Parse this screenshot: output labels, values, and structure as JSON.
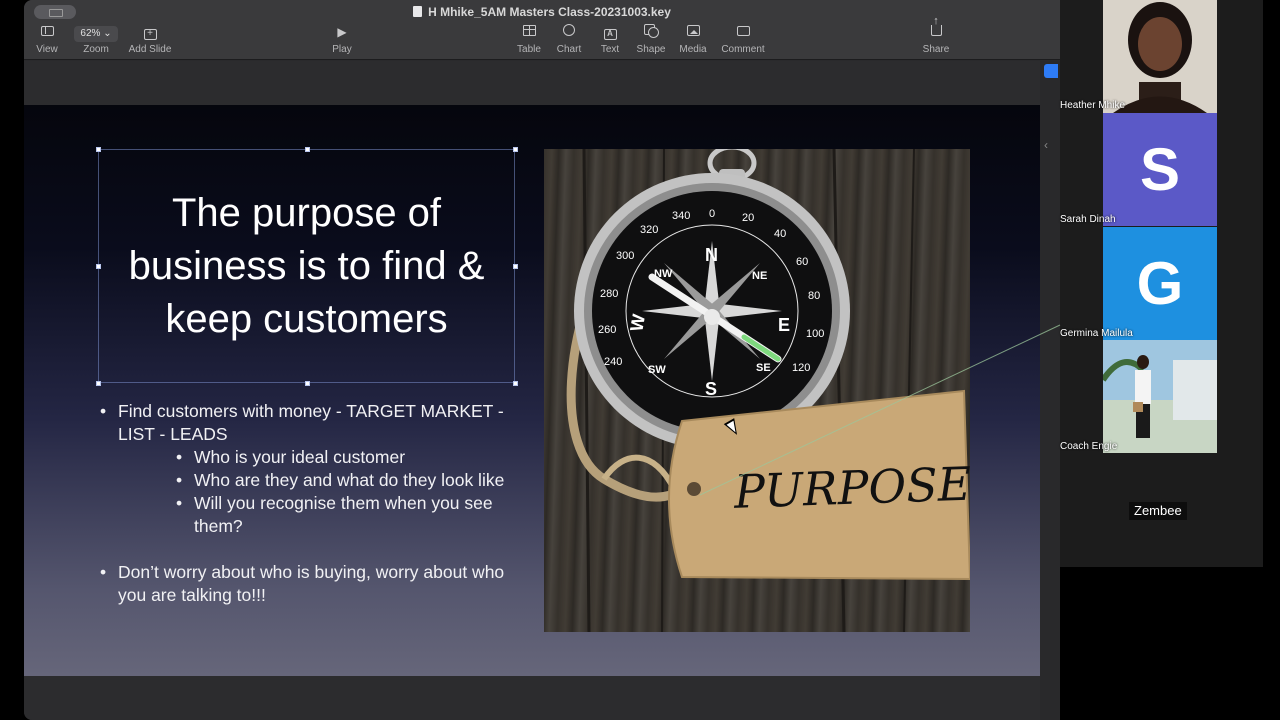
{
  "window": {
    "title": "H Mhike_5AM Masters Class-20231003.key"
  },
  "toolbar": {
    "view_label": "View",
    "zoom_label": "Zoom",
    "zoom_value": "62%",
    "add_slide_label": "Add Slide",
    "play_label": "Play",
    "table_label": "Table",
    "chart_label": "Chart",
    "text_label": "Text",
    "shape_label": "Shape",
    "media_label": "Media",
    "comment_label": "Comment",
    "share_label": "Share"
  },
  "slide": {
    "title": "The purpose of business is to find & keep customers",
    "bullets": {
      "b1": "Find customers with money - TARGET MARKET - LIST - LEADS",
      "b1_sub1": "Who is your ideal customer",
      "b1_sub2": "Who are they and what do they look like",
      "b1_sub3": "Will you recognise them when you see them?",
      "b2": "Don’t worry about who is buying, worry about who you are talking to!!!"
    },
    "image": {
      "tag_text": "PURPOSE",
      "compass_n": "N",
      "compass_e": "E",
      "compass_w": "W",
      "compass_s": "S",
      "compass_ne": "NE",
      "compass_nw": "NW",
      "compass_se": "SE",
      "compass_sw": "SW",
      "deg_0": "0",
      "deg_20": "20",
      "deg_40": "40",
      "deg_60": "60",
      "deg_80": "80",
      "deg_100": "100",
      "deg_120": "120",
      "deg_240": "240",
      "deg_260": "260",
      "deg_280": "280",
      "deg_300": "300",
      "deg_320": "320",
      "deg_340": "340"
    }
  },
  "participants": {
    "p1": {
      "name": "Heather Mhike"
    },
    "p2": {
      "name": "Sarah Dinah",
      "initial": "S",
      "color": "#5b59c7"
    },
    "p3": {
      "name": "Germina Mailula",
      "initial": "G",
      "color": "#1e90e0"
    },
    "p4": {
      "name": "Coach Engie"
    },
    "extra": {
      "name": "Zembee"
    }
  }
}
